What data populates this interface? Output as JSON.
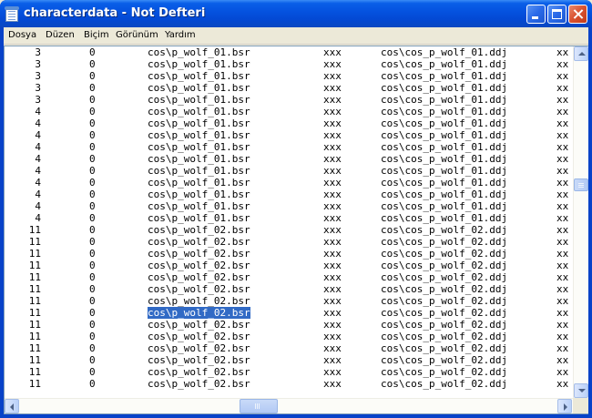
{
  "window": {
    "title": "characterdata - Not Defteri",
    "accent": "#0553e0",
    "selection_color": "#316ac5"
  },
  "menu": [
    {
      "label": "Dosya"
    },
    {
      "label": "Düzen"
    },
    {
      "label": "Biçim"
    },
    {
      "label": "Görünüm"
    },
    {
      "label": "Yardım"
    }
  ],
  "rows": [
    {
      "id": "3",
      "flag": "0",
      "model": "cos\\p_wolf_01.bsr",
      "ph": "xxx",
      "texture": "cos\\cos_p_wolf_01.ddj",
      "extra": "xx"
    },
    {
      "id": "3",
      "flag": "0",
      "model": "cos\\p_wolf_01.bsr",
      "ph": "xxx",
      "texture": "cos\\cos_p_wolf_01.ddj",
      "extra": "xx"
    },
    {
      "id": "3",
      "flag": "0",
      "model": "cos\\p_wolf_01.bsr",
      "ph": "xxx",
      "texture": "cos\\cos_p_wolf_01.ddj",
      "extra": "xx"
    },
    {
      "id": "3",
      "flag": "0",
      "model": "cos\\p_wolf_01.bsr",
      "ph": "xxx",
      "texture": "cos\\cos_p_wolf_01.ddj",
      "extra": "xx"
    },
    {
      "id": "3",
      "flag": "0",
      "model": "cos\\p_wolf_01.bsr",
      "ph": "xxx",
      "texture": "cos\\cos_p_wolf_01.ddj",
      "extra": "xx"
    },
    {
      "id": "4",
      "flag": "0",
      "model": "cos\\p_wolf_01.bsr",
      "ph": "xxx",
      "texture": "cos\\cos_p_wolf_01.ddj",
      "extra": "xx"
    },
    {
      "id": "4",
      "flag": "0",
      "model": "cos\\p_wolf_01.bsr",
      "ph": "xxx",
      "texture": "cos\\cos_p_wolf_01.ddj",
      "extra": "xx"
    },
    {
      "id": "4",
      "flag": "0",
      "model": "cos\\p_wolf_01.bsr",
      "ph": "xxx",
      "texture": "cos\\cos_p_wolf_01.ddj",
      "extra": "xx"
    },
    {
      "id": "4",
      "flag": "0",
      "model": "cos\\p_wolf_01.bsr",
      "ph": "xxx",
      "texture": "cos\\cos_p_wolf_01.ddj",
      "extra": "xx"
    },
    {
      "id": "4",
      "flag": "0",
      "model": "cos\\p_wolf_01.bsr",
      "ph": "xxx",
      "texture": "cos\\cos_p_wolf_01.ddj",
      "extra": "xx"
    },
    {
      "id": "4",
      "flag": "0",
      "model": "cos\\p_wolf_01.bsr",
      "ph": "xxx",
      "texture": "cos\\cos_p_wolf_01.ddj",
      "extra": "xx"
    },
    {
      "id": "4",
      "flag": "0",
      "model": "cos\\p_wolf_01.bsr",
      "ph": "xxx",
      "texture": "cos\\cos_p_wolf_01.ddj",
      "extra": "xx"
    },
    {
      "id": "4",
      "flag": "0",
      "model": "cos\\p_wolf_01.bsr",
      "ph": "xxx",
      "texture": "cos\\cos_p_wolf_01.ddj",
      "extra": "xx"
    },
    {
      "id": "4",
      "flag": "0",
      "model": "cos\\p_wolf_01.bsr",
      "ph": "xxx",
      "texture": "cos\\cos_p_wolf_01.ddj",
      "extra": "xx"
    },
    {
      "id": "4",
      "flag": "0",
      "model": "cos\\p_wolf_01.bsr",
      "ph": "xxx",
      "texture": "cos\\cos_p_wolf_01.ddj",
      "extra": "xx"
    },
    {
      "id": "11",
      "flag": "0",
      "model": "cos\\p_wolf_02.bsr",
      "ph": "xxx",
      "texture": "cos\\cos_p_wolf_02.ddj",
      "extra": "xx"
    },
    {
      "id": "11",
      "flag": "0",
      "model": "cos\\p_wolf_02.bsr",
      "ph": "xxx",
      "texture": "cos\\cos_p_wolf_02.ddj",
      "extra": "xx"
    },
    {
      "id": "11",
      "flag": "0",
      "model": "cos\\p_wolf_02.bsr",
      "ph": "xxx",
      "texture": "cos\\cos_p_wolf_02.ddj",
      "extra": "xx"
    },
    {
      "id": "11",
      "flag": "0",
      "model": "cos\\p_wolf_02.bsr",
      "ph": "xxx",
      "texture": "cos\\cos_p_wolf_02.ddj",
      "extra": "xx"
    },
    {
      "id": "11",
      "flag": "0",
      "model": "cos\\p_wolf_02.bsr",
      "ph": "xxx",
      "texture": "cos\\cos_p_wolf_02.ddj",
      "extra": "xx"
    },
    {
      "id": "11",
      "flag": "0",
      "model": "cos\\p_wolf_02.bsr",
      "ph": "xxx",
      "texture": "cos\\cos_p_wolf_02.ddj",
      "extra": "xx"
    },
    {
      "id": "11",
      "flag": "0",
      "model": "cos\\p_wolf_02.bsr",
      "ph": "xxx",
      "texture": "cos\\cos_p_wolf_02.ddj",
      "extra": "xx"
    },
    {
      "id": "11",
      "flag": "0",
      "model": "cos\\p_wolf_02.bsr",
      "ph": "xxx",
      "texture": "cos\\cos_p_wolf_02.ddj",
      "extra": "xx",
      "selected": true
    },
    {
      "id": "11",
      "flag": "0",
      "model": "cos\\p_wolf_02.bsr",
      "ph": "xxx",
      "texture": "cos\\cos_p_wolf_02.ddj",
      "extra": "xx"
    },
    {
      "id": "11",
      "flag": "0",
      "model": "cos\\p_wolf_02.bsr",
      "ph": "xxx",
      "texture": "cos\\cos_p_wolf_02.ddj",
      "extra": "xx"
    },
    {
      "id": "11",
      "flag": "0",
      "model": "cos\\p_wolf_02.bsr",
      "ph": "xxx",
      "texture": "cos\\cos_p_wolf_02.ddj",
      "extra": "xx"
    },
    {
      "id": "11",
      "flag": "0",
      "model": "cos\\p_wolf_02.bsr",
      "ph": "xxx",
      "texture": "cos\\cos_p_wolf_02.ddj",
      "extra": "xx"
    },
    {
      "id": "11",
      "flag": "0",
      "model": "cos\\p_wolf_02.bsr",
      "ph": "xxx",
      "texture": "cos\\cos_p_wolf_02.ddj",
      "extra": "xx"
    },
    {
      "id": "11",
      "flag": "0",
      "model": "cos\\p_wolf_02.bsr",
      "ph": "xxx",
      "texture": "cos\\cos_p_wolf_02.ddj",
      "extra": "xx"
    }
  ],
  "scroll": {
    "vertical_position": 0.38,
    "horizontal_position": 0.44
  }
}
